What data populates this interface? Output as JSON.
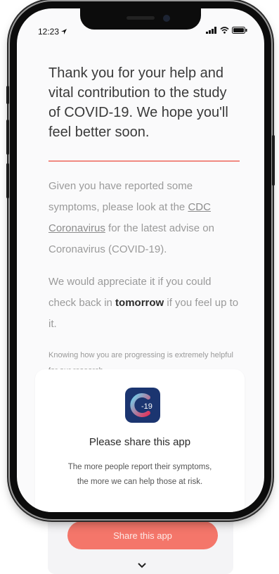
{
  "status_bar": {
    "time": "12:23"
  },
  "thanks": {
    "heading": "Thank you for your help and vital contribution to the study of COVID-19. We hope you'll feel better soon."
  },
  "symptoms": {
    "text_before": "Given you have reported some symptoms, please look at the ",
    "link": "CDC Coronavirus",
    "text_after": " for the latest advise on Coronavirus (COVID-19)."
  },
  "check_back": {
    "text_before": "We would appreciate it if you could check back in ",
    "emphasis": "tomorrow",
    "text_after": " if you feel up to it."
  },
  "research_note": "Knowing how you are progressing is extremely helpful for our research.",
  "share_card": {
    "icon_label": "-19",
    "title": "Please share this app",
    "body": "The more people report their symptoms, the more we can help those at risk."
  },
  "share_button": "Share this app",
  "colors": {
    "accent": "#f4766a",
    "divider": "#f08a82",
    "icon_bg": "#1b3570"
  }
}
